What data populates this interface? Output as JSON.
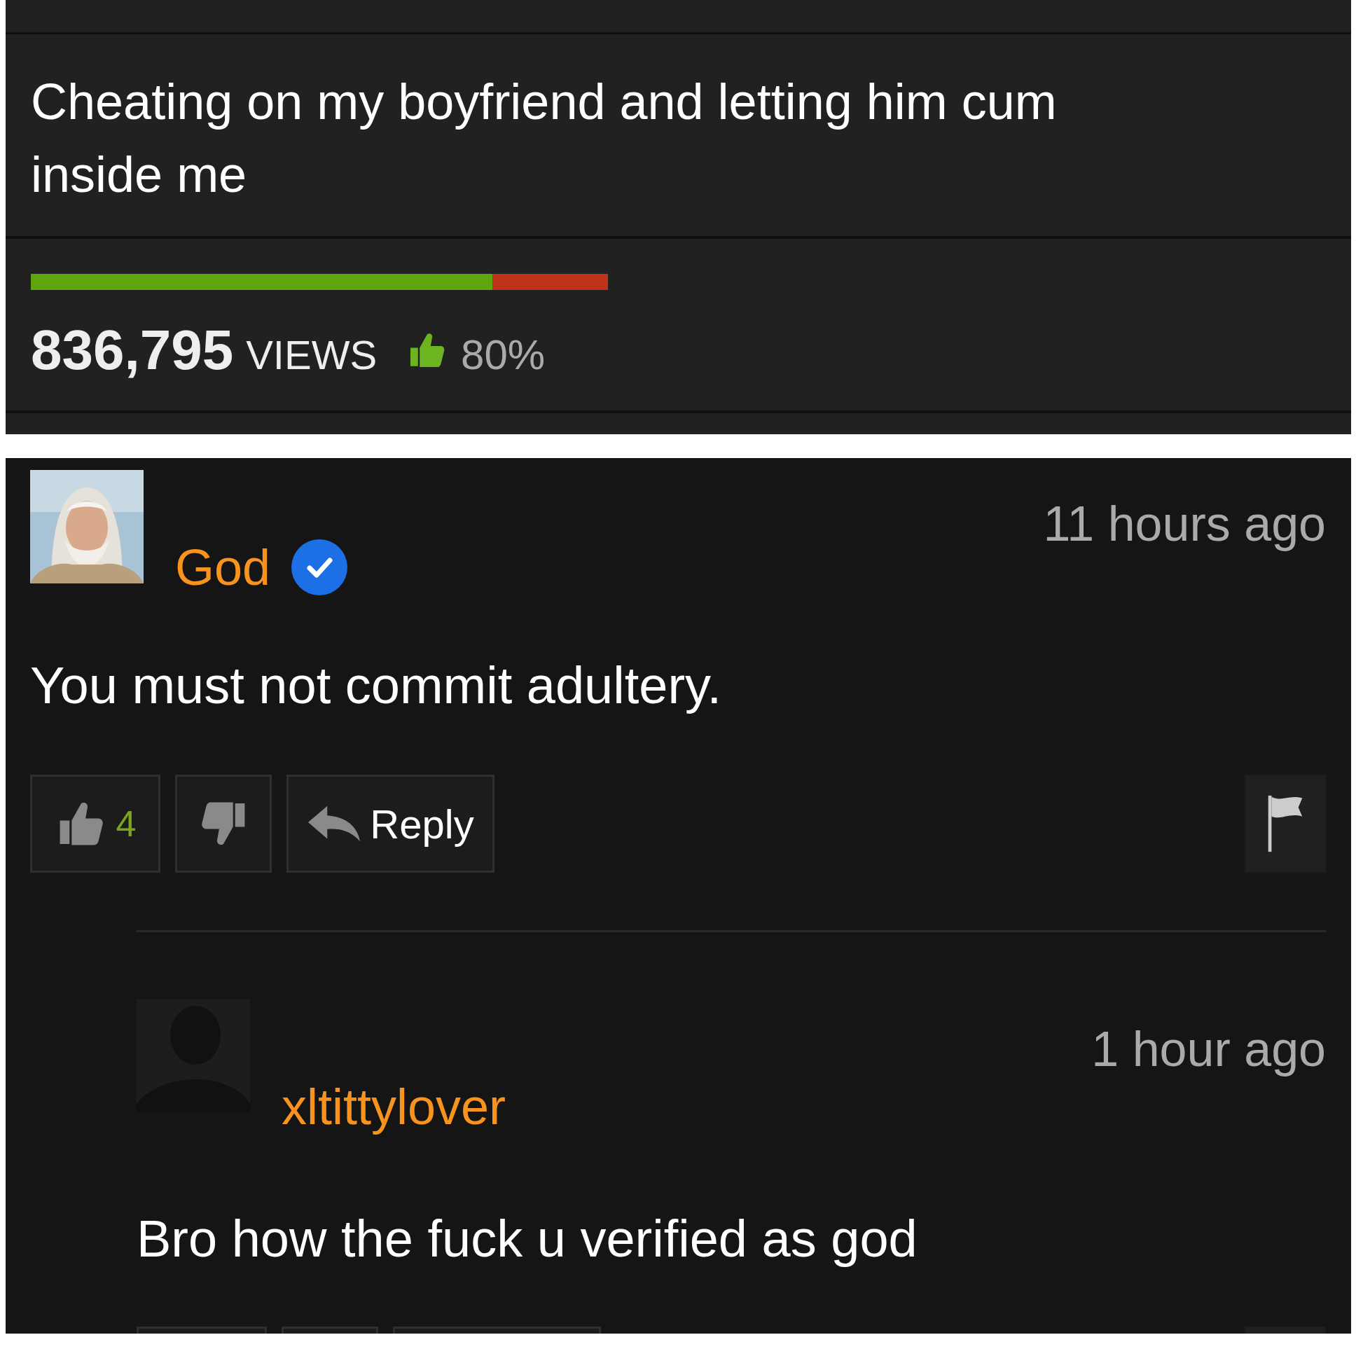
{
  "video": {
    "title": "Cheating on my boyfriend and letting him cum inside me",
    "rating": {
      "level": 0.8
    },
    "views": "836,795",
    "views_label": "VIEWS",
    "approval": "80%"
  },
  "comments": [
    {
      "user": "God",
      "verified": true,
      "time": "11 hours ago",
      "text": "You must not commit adultery.",
      "likes": "4",
      "reply_label": "Reply",
      "replies": [
        {
          "user": "xltittylover",
          "verified": false,
          "avatar": {
            "kind": "silhouette"
          },
          "time": "1 hour ago",
          "text": "Bro how the fuck u verified as god"
        }
      ]
    }
  ]
}
